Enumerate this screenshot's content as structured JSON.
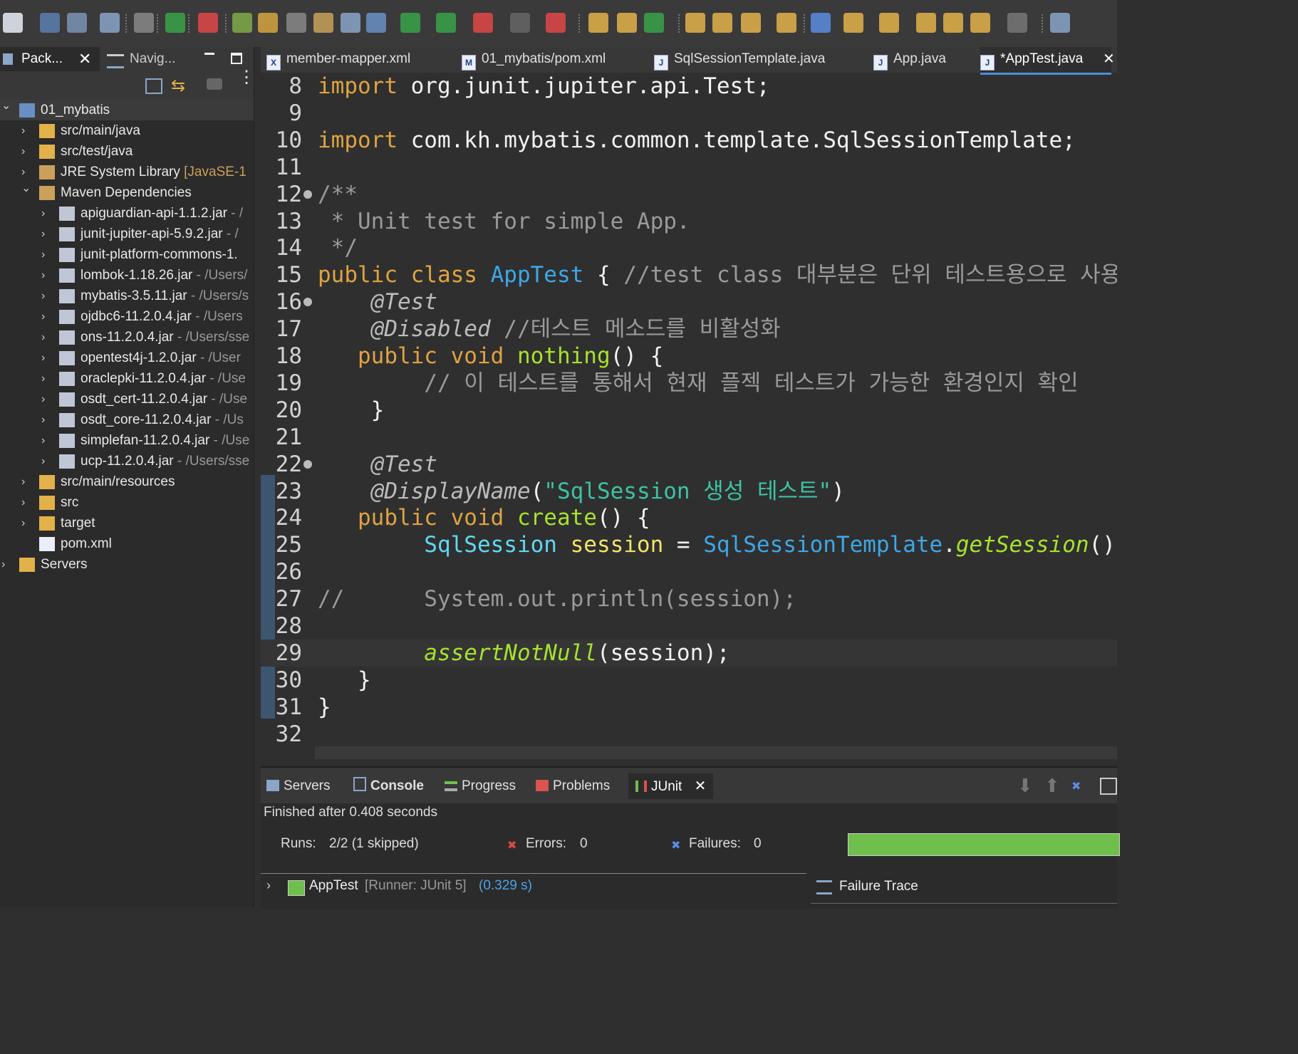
{
  "colors": {
    "background": "#2f2f2f",
    "keyword": "#e0a341",
    "class": "#3ea7e8",
    "string": "#3ec2a4",
    "method": "#a6e22e",
    "variable": "#f2e366",
    "comment": "#9a9a9a",
    "progress": "#6fbf4d"
  },
  "left_panel": {
    "tabs": [
      {
        "label": "Pack...",
        "icon": "package-explorer-icon"
      },
      {
        "label": "Navig...",
        "icon": "navigator-icon"
      }
    ],
    "tree": [
      {
        "label": "01_mybatis",
        "deco": "",
        "level": 0,
        "expanded": true,
        "icon": "maven-project-icon"
      },
      {
        "label": "src/main/java",
        "deco": "",
        "level": 1,
        "expanded": false,
        "icon": "source-folder-icon"
      },
      {
        "label": "src/test/java",
        "deco": "",
        "level": 1,
        "expanded": false,
        "icon": "source-folder-icon"
      },
      {
        "label": "JRE System Library",
        "deco": "[JavaSE-1",
        "level": 1,
        "expanded": false,
        "icon": "library-icon"
      },
      {
        "label": "Maven Dependencies",
        "deco": "",
        "level": 1,
        "expanded": true,
        "icon": "library-icon"
      },
      {
        "label": "apiguardian-api-1.1.2.jar",
        "deco": "- /",
        "level": 2,
        "expanded": false,
        "icon": "jar-icon"
      },
      {
        "label": "junit-jupiter-api-5.9.2.jar",
        "deco": "- /",
        "level": 2,
        "expanded": false,
        "icon": "jar-icon"
      },
      {
        "label": "junit-platform-commons-1.",
        "deco": "",
        "level": 2,
        "expanded": false,
        "icon": "jar-icon"
      },
      {
        "label": "lombok-1.18.26.jar",
        "deco": "- /Users/",
        "level": 2,
        "expanded": false,
        "icon": "jar-icon"
      },
      {
        "label": "mybatis-3.5.11.jar",
        "deco": "- /Users/s",
        "level": 2,
        "expanded": false,
        "icon": "jar-icon"
      },
      {
        "label": "ojdbc6-11.2.0.4.jar",
        "deco": "- /Users",
        "level": 2,
        "expanded": false,
        "icon": "jar-icon"
      },
      {
        "label": "ons-11.2.0.4.jar",
        "deco": "- /Users/sse",
        "level": 2,
        "expanded": false,
        "icon": "jar-icon"
      },
      {
        "label": "opentest4j-1.2.0.jar",
        "deco": "- /User",
        "level": 2,
        "expanded": false,
        "icon": "jar-icon"
      },
      {
        "label": "oraclepki-11.2.0.4.jar",
        "deco": "- /Use",
        "level": 2,
        "expanded": false,
        "icon": "jar-icon"
      },
      {
        "label": "osdt_cert-11.2.0.4.jar",
        "deco": "- /Use",
        "level": 2,
        "expanded": false,
        "icon": "jar-icon"
      },
      {
        "label": "osdt_core-11.2.0.4.jar",
        "deco": "- /Us",
        "level": 2,
        "expanded": false,
        "icon": "jar-icon"
      },
      {
        "label": "simplefan-11.2.0.4.jar",
        "deco": "- /Use",
        "level": 2,
        "expanded": false,
        "icon": "jar-icon"
      },
      {
        "label": "ucp-11.2.0.4.jar",
        "deco": "- /Users/sse",
        "level": 2,
        "expanded": false,
        "icon": "jar-icon"
      },
      {
        "label": "src/main/resources",
        "deco": "",
        "level": 1,
        "expanded": false,
        "icon": "source-folder-icon"
      },
      {
        "label": "src",
        "deco": "",
        "level": 1,
        "expanded": false,
        "icon": "folder-icon"
      },
      {
        "label": "target",
        "deco": "",
        "level": 1,
        "expanded": false,
        "icon": "folder-icon"
      },
      {
        "label": "pom.xml",
        "deco": "",
        "level": 1,
        "expanded": null,
        "icon": "maven-file-icon"
      },
      {
        "label": "Servers",
        "deco": "",
        "level": 0,
        "expanded": false,
        "icon": "folder-icon"
      }
    ]
  },
  "editor": {
    "tabs": [
      {
        "label": "member-mapper.xml",
        "icon": "X",
        "active": false
      },
      {
        "label": "01_mybatis/pom.xml",
        "icon": "M",
        "active": false
      },
      {
        "label": "SqlSessionTemplate.java",
        "icon": "J",
        "active": false
      },
      {
        "label": "App.java",
        "icon": "J",
        "active": false
      },
      {
        "label": "*AppTest.java",
        "icon": "J",
        "active": true
      }
    ],
    "lines": [
      {
        "n": "8",
        "fold": false,
        "hl": false,
        "segs": [
          [
            "kw",
            "import"
          ],
          [
            "plain",
            " org.junit.jupiter.api.Test;"
          ]
        ]
      },
      {
        "n": "9",
        "fold": false,
        "hl": false,
        "segs": []
      },
      {
        "n": "10",
        "fold": false,
        "hl": false,
        "segs": [
          [
            "kw",
            "import"
          ],
          [
            "plain",
            " com.kh.mybatis.common.template.SqlSessionTemplate;"
          ]
        ]
      },
      {
        "n": "11",
        "fold": false,
        "hl": false,
        "segs": []
      },
      {
        "n": "12",
        "fold": true,
        "hl": false,
        "segs": [
          [
            "cmt",
            "/**"
          ]
        ]
      },
      {
        "n": "13",
        "fold": false,
        "hl": false,
        "segs": [
          [
            "cmt",
            " * Unit test for simple App."
          ]
        ]
      },
      {
        "n": "14",
        "fold": false,
        "hl": false,
        "segs": [
          [
            "cmt",
            " */"
          ]
        ]
      },
      {
        "n": "15",
        "fold": false,
        "hl": false,
        "segs": [
          [
            "kw",
            "public class "
          ],
          [
            "cls",
            "AppTest"
          ],
          [
            "plain",
            " { "
          ],
          [
            "cmt",
            "//test class 대부분은 단위 테스트용으로 사용한"
          ]
        ]
      },
      {
        "n": "16",
        "fold": true,
        "hl": false,
        "segs": [
          [
            "ann",
            "    @Test"
          ]
        ]
      },
      {
        "n": "17",
        "fold": false,
        "hl": false,
        "segs": [
          [
            "ann",
            "    @Disabled"
          ],
          [
            "cmt",
            " //테스트 메소드를 비활성화"
          ]
        ]
      },
      {
        "n": "18",
        "fold": false,
        "hl": false,
        "segs": [
          [
            "kw",
            "   public void "
          ],
          [
            "mth",
            "nothing"
          ],
          [
            "plain",
            "() {"
          ]
        ]
      },
      {
        "n": "19",
        "fold": false,
        "hl": false,
        "segs": [
          [
            "cmt",
            "        // 이 테스트를 통해서 현재 플젝 테스트가 가능한 환경인지 확인"
          ]
        ]
      },
      {
        "n": "20",
        "fold": false,
        "hl": false,
        "segs": [
          [
            "plain",
            "    }"
          ]
        ]
      },
      {
        "n": "21",
        "fold": false,
        "hl": false,
        "segs": []
      },
      {
        "n": "22",
        "fold": true,
        "hl": false,
        "segs": [
          [
            "ann",
            "    @Test"
          ]
        ]
      },
      {
        "n": "23",
        "fold": false,
        "hl": false,
        "segs": [
          [
            "ann",
            "    @DisplayName"
          ],
          [
            "plain",
            "("
          ],
          [
            "str",
            "\"SqlSession 생성 테스트\""
          ],
          [
            "plain",
            ")"
          ]
        ]
      },
      {
        "n": "24",
        "fold": false,
        "hl": false,
        "segs": [
          [
            "kw",
            "   public void "
          ],
          [
            "mth",
            "create"
          ],
          [
            "plain",
            "() {"
          ]
        ]
      },
      {
        "n": "25",
        "fold": false,
        "hl": false,
        "segs": [
          [
            "typ",
            "        SqlSession"
          ],
          [
            "var",
            " session"
          ],
          [
            "plain",
            " = "
          ],
          [
            "cls",
            "SqlSessionTemplate"
          ],
          [
            "plain",
            "."
          ],
          [
            "mthi",
            "getSession"
          ],
          [
            "plain",
            "()"
          ]
        ]
      },
      {
        "n": "26",
        "fold": false,
        "hl": false,
        "segs": []
      },
      {
        "n": "27",
        "fold": false,
        "hl": false,
        "segs": [
          [
            "cmt",
            "//      System.out.println(session);"
          ]
        ]
      },
      {
        "n": "28",
        "fold": false,
        "hl": false,
        "segs": []
      },
      {
        "n": "29",
        "fold": false,
        "hl": true,
        "segs": [
          [
            "mthi",
            "        assertNotNull"
          ],
          [
            "plain",
            "(session);"
          ]
        ]
      },
      {
        "n": "30",
        "fold": false,
        "hl": false,
        "segs": [
          [
            "plain",
            "   }"
          ]
        ]
      },
      {
        "n": "31",
        "fold": false,
        "hl": false,
        "segs": [
          [
            "plain",
            "}"
          ]
        ]
      },
      {
        "n": "32",
        "fold": false,
        "hl": false,
        "segs": []
      }
    ]
  },
  "bottom": {
    "tabs": [
      {
        "label": "Servers",
        "active": false
      },
      {
        "label": "Console",
        "active": false
      },
      {
        "label": "Progress",
        "active": false
      },
      {
        "label": "Problems",
        "active": false
      },
      {
        "label": "JUnit",
        "active": true
      }
    ],
    "status": "Finished after 0.408 seconds",
    "runs_label": "Runs:",
    "runs_value": "2/2 (1 skipped)",
    "errors_label": "Errors:",
    "errors_value": "0",
    "failures_label": "Failures:",
    "failures_value": "0",
    "result_name": "AppTest",
    "result_runner": "[Runner: JUnit 5]",
    "result_time": "(0.329 s)",
    "failure_trace_label": "Failure Trace",
    "progress_fraction": 1.0
  }
}
